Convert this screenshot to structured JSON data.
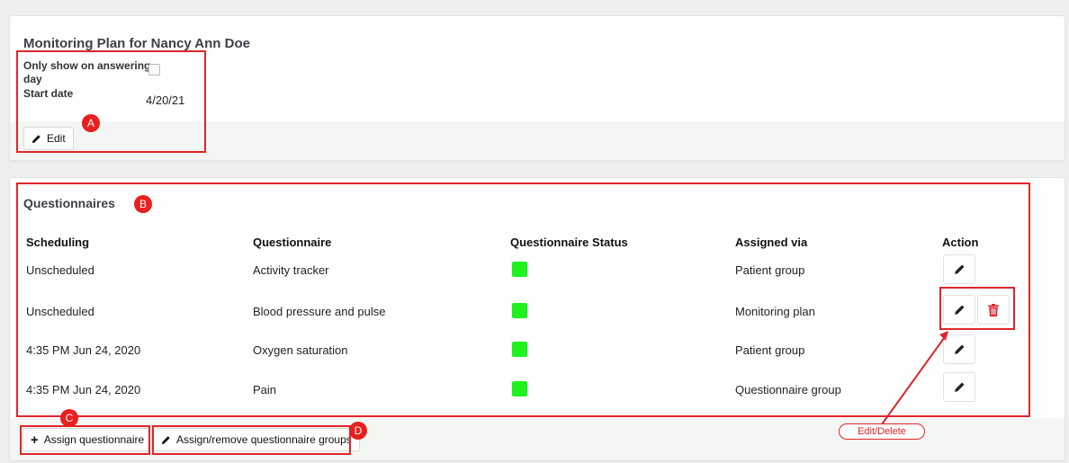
{
  "plan": {
    "title": "Monitoring Plan for Nancy Ann Doe",
    "only_show_label_1": "Only show on answering",
    "only_show_label_2": "day",
    "start_date_label": "Start date",
    "start_date_value": "4/20/21",
    "edit_label": "Edit",
    "only_show_checked": false
  },
  "questionnaires": {
    "title": "Questionnaires",
    "headers": [
      "Scheduling",
      "Questionnaire",
      "Questionnaire Status",
      "Assigned via",
      "Action"
    ],
    "rows": [
      {
        "scheduling": "Unscheduled",
        "questionnaire": "Activity tracker",
        "status_color": "#1ef21e",
        "assigned_via": "Patient group"
      },
      {
        "scheduling": "Unscheduled",
        "questionnaire": "Blood pressure and pulse",
        "status_color": "#1ef21e",
        "assigned_via": "Monitoring plan"
      },
      {
        "scheduling": "4:35 PM Jun 24, 2020",
        "questionnaire": "Oxygen saturation",
        "status_color": "#1ef21e",
        "assigned_via": "Patient group"
      },
      {
        "scheduling": "4:35 PM Jun 24, 2020",
        "questionnaire": "Pain",
        "status_color": "#1ef21e",
        "assigned_via": "Questionnaire group"
      }
    ],
    "assign_label": "Assign questionnaire",
    "assign_groups_label": "Assign/remove questionnaire groups"
  },
  "annotations": {
    "badge_a": "A",
    "badge_b": "B",
    "badge_c": "C",
    "badge_d": "D",
    "edit_delete": "Edit/Delete"
  },
  "colors": {
    "annotation_red": "#e0262a",
    "status_green": "#1ef21e",
    "delete_red": "#e0262a"
  }
}
